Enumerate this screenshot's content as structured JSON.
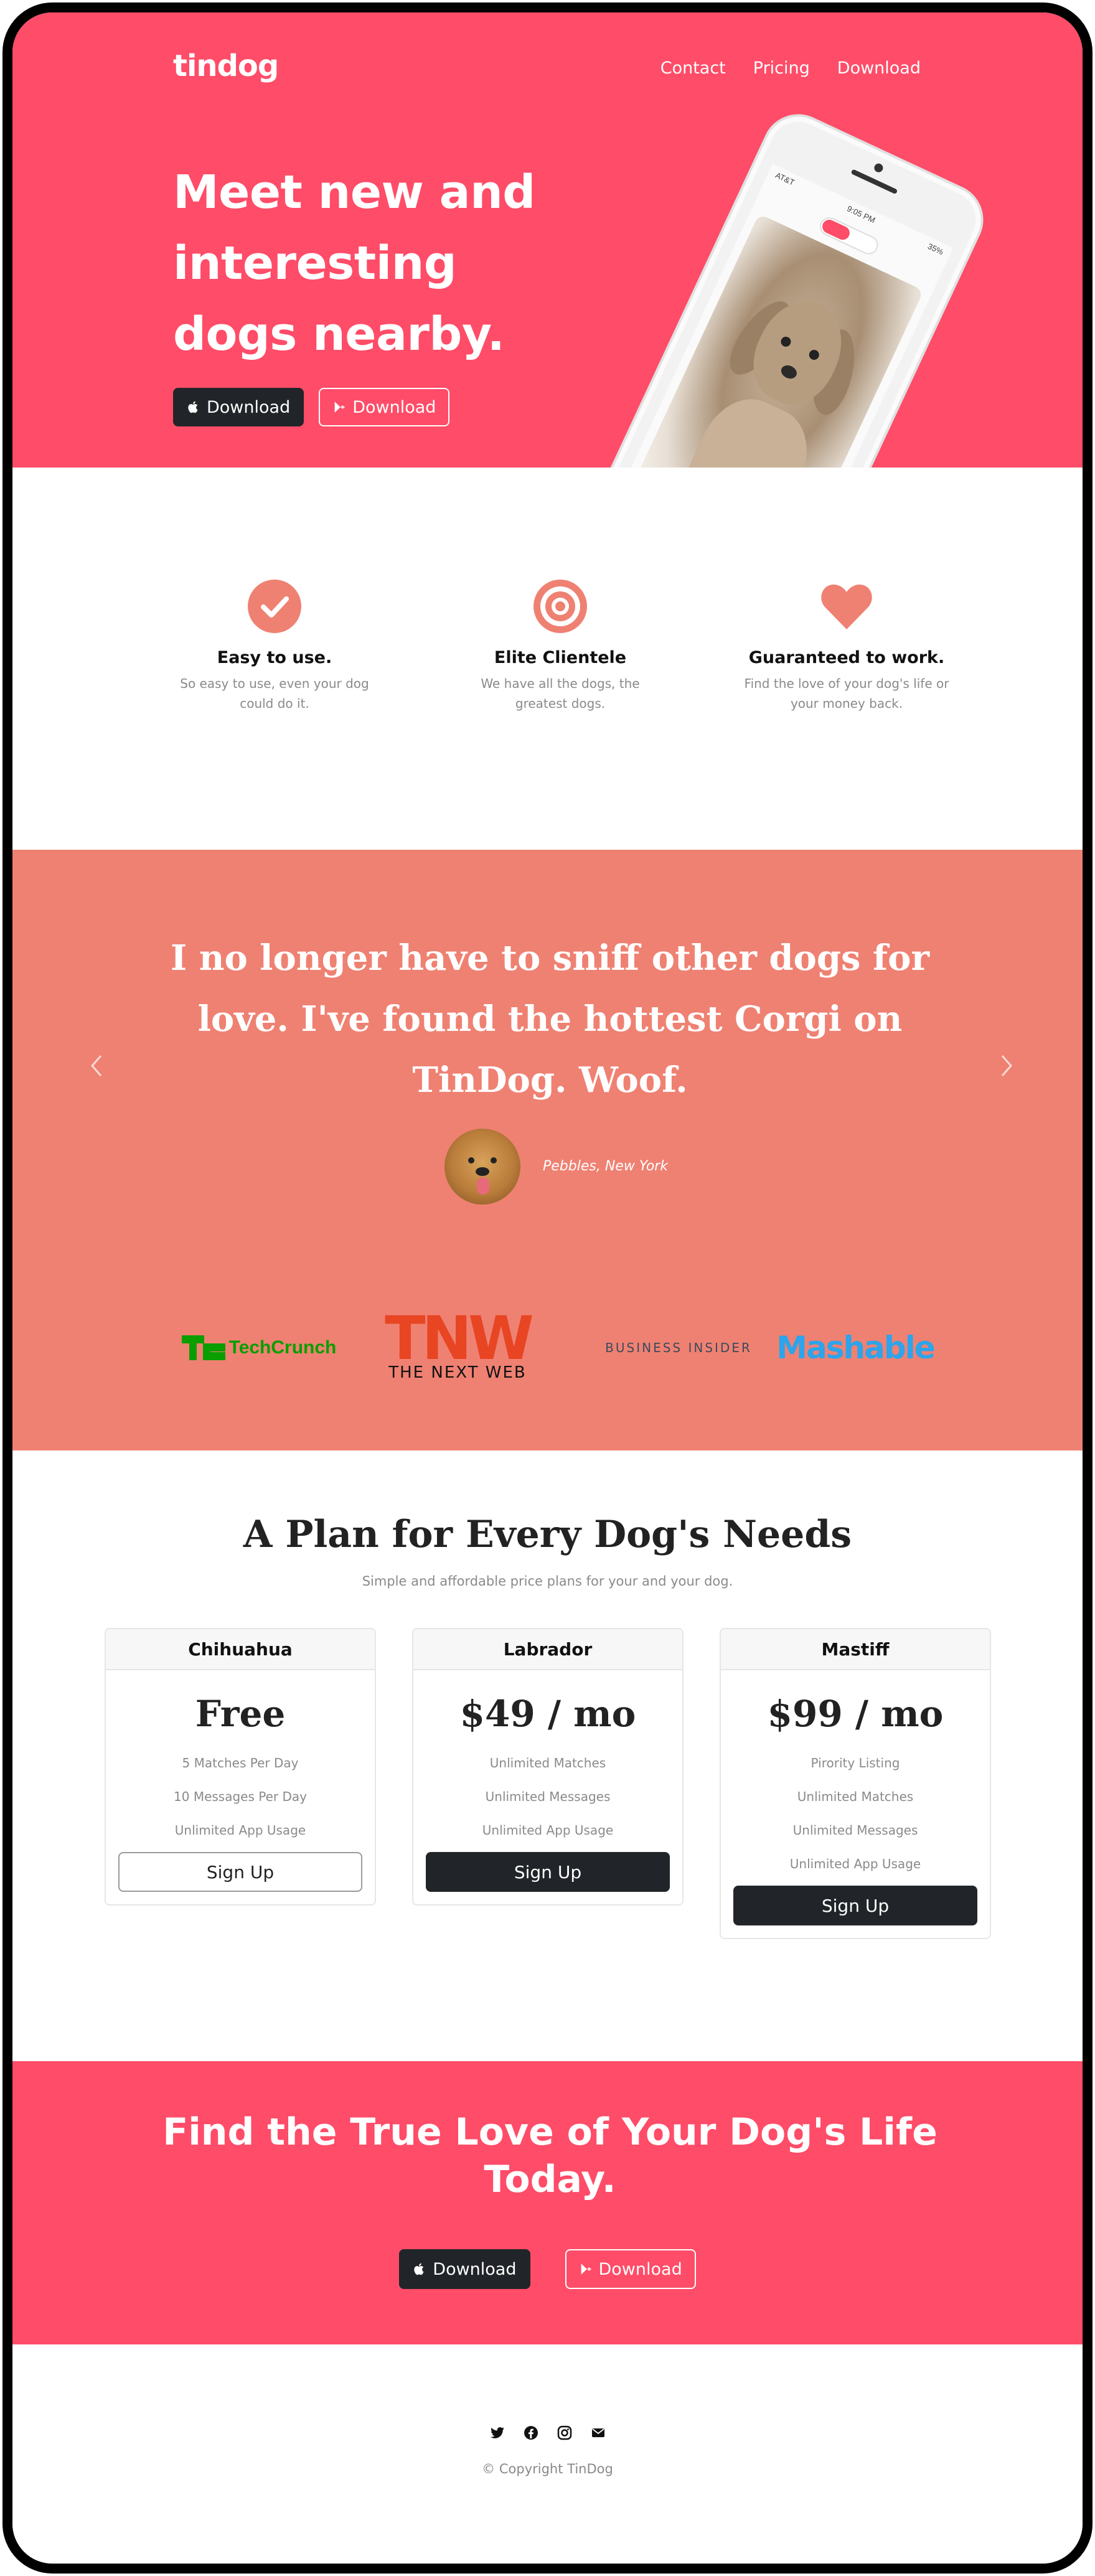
{
  "brand": "tindog",
  "nav": {
    "contact": "Contact",
    "pricing": "Pricing",
    "download": "Download"
  },
  "hero": {
    "title": "Meet new and interesting dogs nearby.",
    "apple_button": "Download",
    "google_button": "Download",
    "phone_time": "9:05 PM",
    "phone_carrier": "AT&T",
    "phone_battery": "35%"
  },
  "features": [
    {
      "icon": "check-circle-icon",
      "title": "Easy to use.",
      "text": "So easy to use, even your dog could do it."
    },
    {
      "icon": "bullseye-icon",
      "title": "Elite Clientele",
      "text": "We have all the dogs, the greatest dogs."
    },
    {
      "icon": "heart-icon",
      "title": "Guaranteed to work.",
      "text": "Find the love of your dog's life or your money back."
    }
  ],
  "testimonial": {
    "quote": "I no longer have to sniff other dogs for love. I've found the hottest Corgi on TinDog. Woof.",
    "author": "Pebbles, New York"
  },
  "press": {
    "techcrunch": "TechCrunch",
    "tnw_logo": "TNW",
    "tnw_sub": "THE NEXT WEB",
    "business_insider": "BUSINESS INSIDER",
    "mashable": "Mashable"
  },
  "pricing": {
    "title": "A Plan for Every Dog's Needs",
    "subtitle": "Simple and affordable price plans for your and your dog.",
    "plans": [
      {
        "name": "Chihuahua",
        "price": "Free",
        "features": [
          "5 Matches Per Day",
          "10 Messages Per Day",
          "Unlimited App Usage"
        ],
        "button": "Sign Up"
      },
      {
        "name": "Labrador",
        "price": "$49 / mo",
        "features": [
          "Unlimited Matches",
          "Unlimited Messages",
          "Unlimited App Usage"
        ],
        "button": "Sign Up"
      },
      {
        "name": "Mastiff",
        "price": "$99 / mo",
        "features": [
          "Pirority Listing",
          "Unlimited Matches",
          "Unlimited Messages",
          "Unlimited App Usage"
        ],
        "button": "Sign Up"
      }
    ]
  },
  "cta": {
    "title": "Find the True Love of Your Dog's Life Today.",
    "apple_button": "Download",
    "google_button": "Download"
  },
  "footer": {
    "social_icons": [
      "twitter-icon",
      "facebook-icon",
      "instagram-icon",
      "envelope-icon"
    ],
    "copyright": "© Copyright TinDog"
  },
  "colors": {
    "primary_red": "#ff4c68",
    "salmon": "#ef8172",
    "dark": "#212529",
    "muted_text": "#8a8a8a"
  }
}
